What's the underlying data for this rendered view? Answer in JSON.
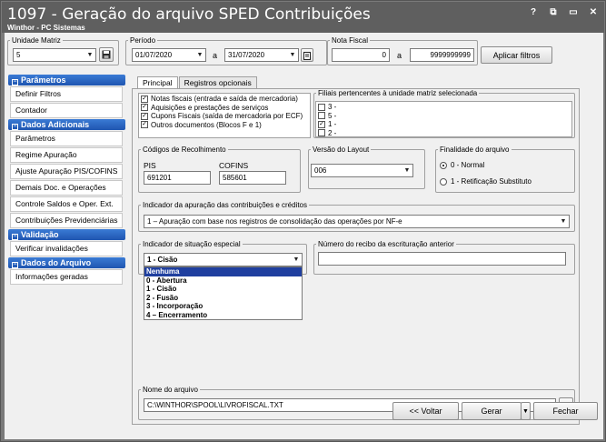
{
  "window": {
    "title": "1097 - Geração do arquivo SPED Contribuições",
    "subtitle": "Winthor - PC Sistemas",
    "controls": {
      "help": "?",
      "restore": "⧉",
      "minimize": "▭",
      "close": "✕"
    }
  },
  "filters": {
    "unidade_label": "Unidade Matriz",
    "unidade_value": "5",
    "periodo_label": "Período",
    "date_from": "01/07/2020",
    "date_sep": "a",
    "date_to": "31/07/2020",
    "nota_label": "Nota Fiscal",
    "nota_from": "0",
    "nota_sep": "a",
    "nota_to": "9999999999",
    "apply_label": "Aplicar filtros"
  },
  "sidebar": {
    "sections": [
      {
        "title": "Parâmetros",
        "items": [
          "Definir Filtros",
          "Contador"
        ]
      },
      {
        "title": "Dados Adicionais",
        "items": [
          "Parâmetros",
          "Regime Apuração",
          "Ajuste Apuração PIS/COFINS",
          "Demais Doc. e Operações",
          "Controle Saldos e Oper. Ext.",
          "Contribuições Previdenciárias"
        ]
      },
      {
        "title": "Validação",
        "items": [
          "Verificar invalidações"
        ]
      },
      {
        "title": "Dados do Arquivo",
        "items": [
          "Informações geradas"
        ]
      }
    ]
  },
  "tabs": [
    {
      "label": "Principal"
    },
    {
      "label": "Registros opcionais"
    }
  ],
  "documents": {
    "items": [
      {
        "label": "Notas fiscais (entrada e saída de mercadoria)",
        "checked": true
      },
      {
        "label": "Aquisições e prestações de serviços",
        "checked": true
      },
      {
        "label": "Cupons Fiscais (saída de mercadoria por ECF)",
        "checked": true
      },
      {
        "label": "Outros documentos (Blocos F e 1)",
        "checked": true
      }
    ]
  },
  "filiais": {
    "label": "Filiais pertencentes à unidade matriz selecionada",
    "items": [
      {
        "label": "3 -",
        "checked": false
      },
      {
        "label": "5 -",
        "checked": false
      },
      {
        "label": "1 -",
        "checked": true
      },
      {
        "label": "2 -",
        "checked": false
      }
    ]
  },
  "codigos": {
    "label": "Códigos de Recolhimento",
    "pis_label": "PIS",
    "pis_value": "691201",
    "cofins_label": "COFINS",
    "cofins_value": "585601"
  },
  "layout": {
    "label": "Versão do Layout",
    "value": "006"
  },
  "finalidade": {
    "label": "Finalidade do arquivo",
    "options": [
      {
        "label": "0 - Normal",
        "selected": true
      },
      {
        "label": "1 - Retificação Substituto",
        "selected": false
      }
    ]
  },
  "indicador_apuracao": {
    "label": "Indicador da apuração das contribuições e créditos",
    "value": "1 – Apuração com base nos registros de consolidação das operações por NF-e"
  },
  "situacao": {
    "label": "Indicador de situação especial",
    "value": "1 - Cisão",
    "options": [
      "Nenhuma",
      "0 - Abertura",
      "1 - Cisão",
      "2 - Fusão",
      "3 - Incorporação",
      "4 – Encerramento"
    ],
    "highlighted_index": 0
  },
  "recibo": {
    "label": "Número do recibo da escrituração anterior",
    "value": ""
  },
  "arquivo": {
    "label": "Nome do arquivo",
    "value": "C:\\WINTHOR\\SPOOL\\LIVROFISCAL.TXT"
  },
  "footer": {
    "voltar": "<< Voltar",
    "gerar": "Gerar",
    "fechar": "Fechar"
  }
}
